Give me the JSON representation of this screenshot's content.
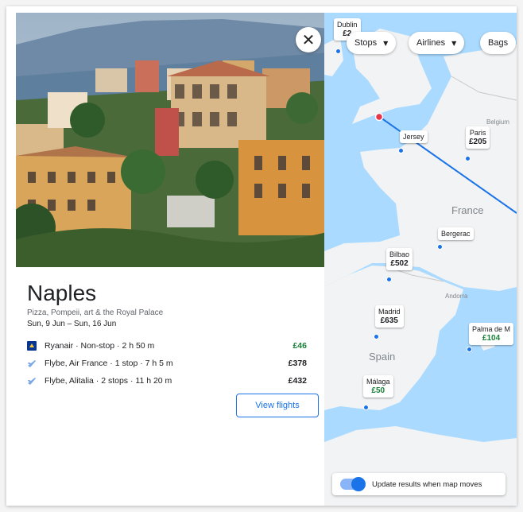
{
  "destination": {
    "city": "Naples",
    "tagline": "Pizza, Pompeii, art & the Royal Palace",
    "dates": "Sun, 9 Jun – Sun, 16 Jun",
    "close_icon": "close-icon"
  },
  "flights": [
    {
      "airline": "Ryanair · Non-stop · 2 h 50 m",
      "price": "£46",
      "cheap": true,
      "icon": "ryanair-logo-icon"
    },
    {
      "airline": "Flybe, Air France · 1 stop · 7 h 5 m",
      "price": "£378",
      "cheap": false,
      "icon": "plane-icon"
    },
    {
      "airline": "Flybe, Alitalia · 2 stops · 11 h 20 m",
      "price": "£432",
      "cheap": false,
      "icon": "plane-icon"
    }
  ],
  "view_flights_label": "View flights",
  "filters": {
    "stops": "Stops",
    "airlines": "Airlines",
    "bags": "Bags"
  },
  "map": {
    "pins": [
      {
        "city": "Dublin",
        "price": "£2"
      },
      {
        "city": "Jersey",
        "price": ""
      },
      {
        "city": "Paris",
        "price": "£205"
      },
      {
        "city": "Bergerac",
        "price": ""
      },
      {
        "city": "Bilbao",
        "price": "£502"
      },
      {
        "city": "Madrid",
        "price": "£635"
      },
      {
        "city": "Palma de M",
        "price": "£104"
      },
      {
        "city": "Málaga",
        "price": "£50"
      }
    ],
    "labels": {
      "france": "France",
      "spain": "Spain",
      "andorra": "Andorra",
      "belgium": "Belgium"
    },
    "update_label": "Update results when map moves",
    "update_enabled": true
  },
  "colors": {
    "accent": "#1a73e8",
    "cheap": "#188038",
    "sea": "#aadaff",
    "land": "#f1f3f4"
  }
}
